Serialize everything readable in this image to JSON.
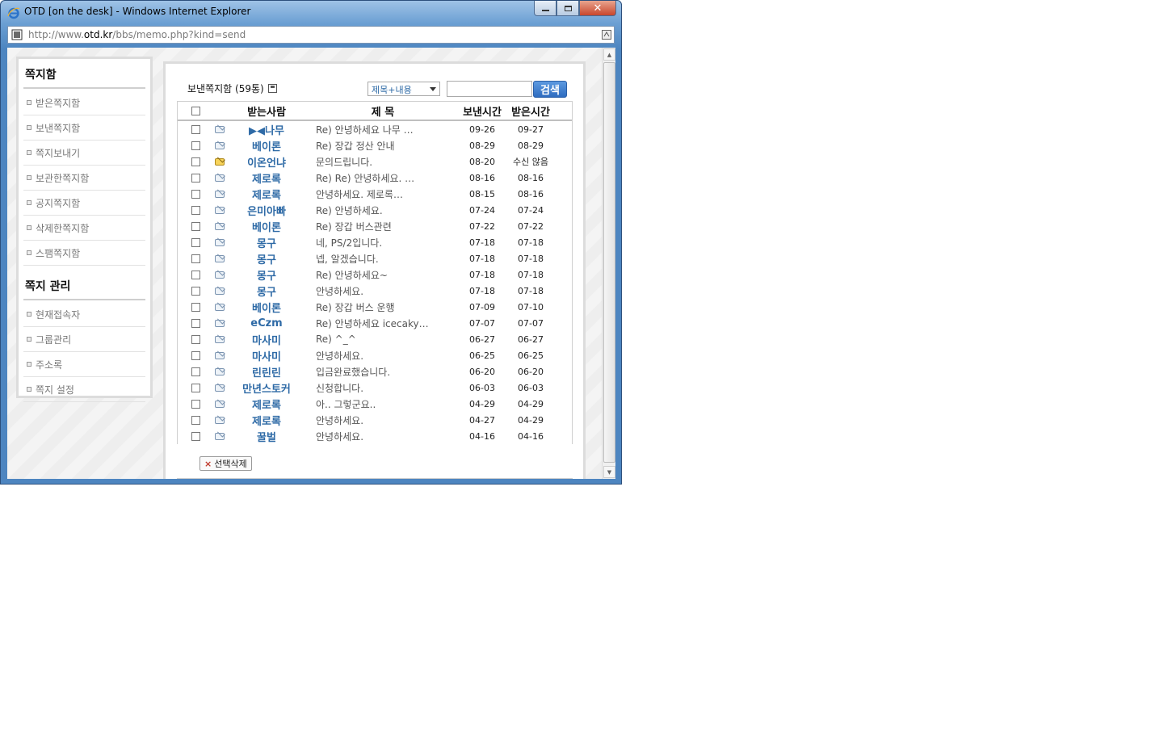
{
  "window": {
    "title": "OTD [on the desk] - Windows Internet Explorer",
    "url_prefix": "http://www.",
    "url_domain": "otd.kr",
    "url_path": "/bbs/memo.php?kind=send"
  },
  "sidebar": {
    "heading1": "쪽지함",
    "items1": [
      "받은쪽지함",
      "보낸쪽지함",
      "쪽지보내기",
      "보관한쪽지함",
      "공지쪽지함",
      "삭제한쪽지함",
      "스팸쪽지함"
    ],
    "heading2": "쪽지 관리",
    "items2": [
      "현재접속자",
      "그룹관리",
      "주소록",
      "쪽지 설정"
    ]
  },
  "main": {
    "heading": "보낸쪽지함 (59통)",
    "search_option": "제목+내용",
    "search_button": "검색",
    "columns": {
      "to": "받는사람",
      "subject": "제 목",
      "sent": "보낸시간",
      "received": "받은시간"
    },
    "delete_button": "선택삭제",
    "rows": [
      {
        "to": "▶◀나무",
        "subject": "Re) 안녕하세요 나무 …",
        "sent": "09-26",
        "received": "09-27",
        "read": true
      },
      {
        "to": "베이론",
        "subject": "Re) 장갑 정산 안내",
        "sent": "08-29",
        "received": "08-29",
        "read": true
      },
      {
        "to": "이온언냐",
        "subject": "문의드립니다.",
        "sent": "08-20",
        "received": "수신 않음",
        "read": false
      },
      {
        "to": "제로록",
        "subject": "Re) Re) 안녕하세요. …",
        "sent": "08-16",
        "received": "08-16",
        "read": true
      },
      {
        "to": "제로록",
        "subject": "안녕하세요. 제로록…",
        "sent": "08-15",
        "received": "08-16",
        "read": true
      },
      {
        "to": "은미아빠",
        "subject": "Re) 안녕하세요.",
        "sent": "07-24",
        "received": "07-24",
        "read": true
      },
      {
        "to": "베이론",
        "subject": "Re) 장갑 버스관련",
        "sent": "07-22",
        "received": "07-22",
        "read": true
      },
      {
        "to": "몽구",
        "subject": "네, PS/2입니다.",
        "sent": "07-18",
        "received": "07-18",
        "read": true
      },
      {
        "to": "몽구",
        "subject": "넵, 알겠습니다.",
        "sent": "07-18",
        "received": "07-18",
        "read": true
      },
      {
        "to": "몽구",
        "subject": "Re) 안녕하세요~",
        "sent": "07-18",
        "received": "07-18",
        "read": true
      },
      {
        "to": "몽구",
        "subject": "안녕하세요.",
        "sent": "07-18",
        "received": "07-18",
        "read": true
      },
      {
        "to": "베이론",
        "subject": "Re) 장갑 버스 운행",
        "sent": "07-09",
        "received": "07-10",
        "read": true
      },
      {
        "to": "eCzm",
        "subject": "Re) 안녕하세요 icecaky…",
        "sent": "07-07",
        "received": "07-07",
        "read": true
      },
      {
        "to": "마사미",
        "subject": "Re) ^_^",
        "sent": "06-27",
        "received": "06-27",
        "read": true
      },
      {
        "to": "마사미",
        "subject": "안녕하세요.",
        "sent": "06-25",
        "received": "06-25",
        "read": true
      },
      {
        "to": "린린린",
        "subject": "입금완료했습니다.",
        "sent": "06-20",
        "received": "06-20",
        "read": true
      },
      {
        "to": "만년스토커",
        "subject": "신청합니다.",
        "sent": "06-03",
        "received": "06-03",
        "read": true
      },
      {
        "to": "제로록",
        "subject": "아.. 그렇군요..",
        "sent": "04-29",
        "received": "04-29",
        "read": true
      },
      {
        "to": "제로록",
        "subject": "안녕하세요.",
        "sent": "04-27",
        "received": "04-29",
        "read": true
      },
      {
        "to": "꿀벌",
        "subject": "안녕하세요.",
        "sent": "04-16",
        "received": "04-16",
        "read": true
      }
    ]
  }
}
